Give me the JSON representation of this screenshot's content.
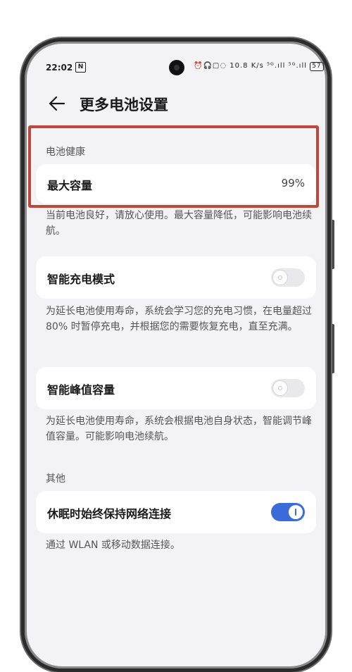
{
  "status_bar": {
    "time": "22:02",
    "n_badge": "N",
    "icons": "⏰🎧▢◌ 10.8 K/s ⁵ᴳ.ıll ⁵ᴳ.ıll",
    "battery": "57"
  },
  "header": {
    "title": "更多电池设置"
  },
  "battery_health": {
    "section_label": "电池健康",
    "max_capacity_label": "最大容量",
    "max_capacity_value": "99%",
    "description": "当前电池良好，请放心使用。最大容量降低，可能影响电池续航。"
  },
  "smart_charging": {
    "label": "智能充电模式",
    "enabled": false,
    "description": "为延长电池使用寿命，系统会学习您的充电习惯，在电量超过 80% 时暂停充电，并根据您的需要恢复充电，直至充满。"
  },
  "smart_peak": {
    "label": "智能峰值容量",
    "enabled": false,
    "description": "为延长电池使用寿命，系统会根据电池自身状态，智能调节峰值容量。可能影响电池续航。"
  },
  "other": {
    "section_label": "其他",
    "keep_network_label": "休眠时始终保持网络连接",
    "keep_network_enabled": true,
    "description": "通过 WLAN 或移动数据连接。"
  },
  "colors": {
    "highlight": "#c0453b",
    "toggle_on": "#3a6bd9",
    "background": "#f3f3f5"
  }
}
